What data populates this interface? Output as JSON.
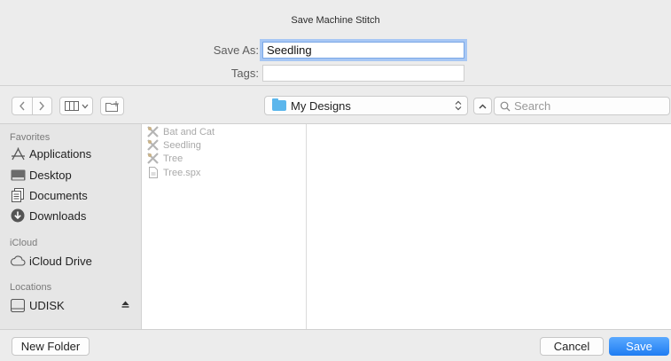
{
  "dialog": {
    "title": "Save Machine Stitch",
    "save_as_label": "Save As:",
    "save_as_value": "Seedling",
    "tags_label": "Tags:",
    "tags_value": ""
  },
  "toolbar": {
    "back_icon": "chevron-left-icon",
    "forward_icon": "chevron-right-icon",
    "view_icon": "column-view-icon",
    "new_folder_icon": "new-folder-icon",
    "location": "My Designs",
    "search_placeholder": "Search"
  },
  "sidebar": {
    "favorites_header": "Favorites",
    "favorites": [
      {
        "label": "Applications",
        "icon": "applications-icon"
      },
      {
        "label": "Desktop",
        "icon": "desktop-icon"
      },
      {
        "label": "Documents",
        "icon": "documents-icon"
      },
      {
        "label": "Downloads",
        "icon": "downloads-icon"
      }
    ],
    "icloud_header": "iCloud",
    "icloud": [
      {
        "label": "iCloud Drive",
        "icon": "cloud-icon"
      }
    ],
    "locations_header": "Locations",
    "locations": [
      {
        "label": "UDISK",
        "icon": "disk-icon",
        "eject": "eject-icon"
      }
    ]
  },
  "files": [
    {
      "name": "Bat and Cat",
      "icon": "stitch-icon"
    },
    {
      "name": "Seedling",
      "icon": "stitch-icon"
    },
    {
      "name": "Tree",
      "icon": "stitch-icon"
    },
    {
      "name": "Tree.spx",
      "icon": "document-icon"
    }
  ],
  "footer": {
    "new_folder": "New Folder",
    "cancel": "Cancel",
    "save": "Save"
  },
  "colors": {
    "accent": "#1f7df2",
    "folder": "#5bb6ec",
    "focus_ring": "#a7c7f4"
  }
}
